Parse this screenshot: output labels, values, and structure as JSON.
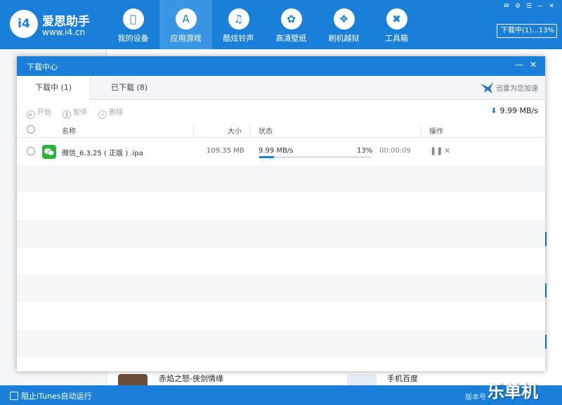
{
  "app": {
    "brand_logo": "i4",
    "brand_name": "爱思助手",
    "brand_url": "www.i4.cn",
    "accent": "#1a7fd8",
    "nav": [
      {
        "label": "我的设备",
        "icon": "apple-icon"
      },
      {
        "label": "应用游戏",
        "icon": "app-store-icon",
        "active": true
      },
      {
        "label": "酷炫铃声",
        "icon": "bell-icon"
      },
      {
        "label": "高清壁纸",
        "icon": "flower-icon"
      },
      {
        "label": "刷机越狱",
        "icon": "dropbox-icon"
      },
      {
        "label": "工具箱",
        "icon": "tools-icon"
      }
    ],
    "download_status": "下载中(1)...13%"
  },
  "background": {
    "apps": [
      {
        "name": "赤焰之怒-侠剑情缘"
      },
      {
        "name": "手机百度"
      }
    ],
    "status_itunes": "阻止iTunes自动运行",
    "status_version": "版本号",
    "watermark": "乐单机"
  },
  "dialog": {
    "title": "下载中心",
    "tabs": [
      {
        "label": "下载中 (1)",
        "active": true
      },
      {
        "label": "已下载 (8)",
        "active": false
      }
    ],
    "thunder_text": "迅雷为您加速",
    "toolbar": {
      "start": "开始",
      "pause": "暂停",
      "delete": "删除"
    },
    "total_speed": "9.99 MB/s",
    "columns": {
      "name": "名称",
      "size": "大小",
      "status": "状态",
      "actions": "操作"
    },
    "downloads": [
      {
        "name": "微信_6.3.25 ( 正版 ) .ipa",
        "icon": "wechat-icon",
        "size": "109.35 MB",
        "speed": "9.99 MB/s",
        "percent_text": "13%",
        "progress": 0.13,
        "time": "00:00:09"
      }
    ]
  }
}
